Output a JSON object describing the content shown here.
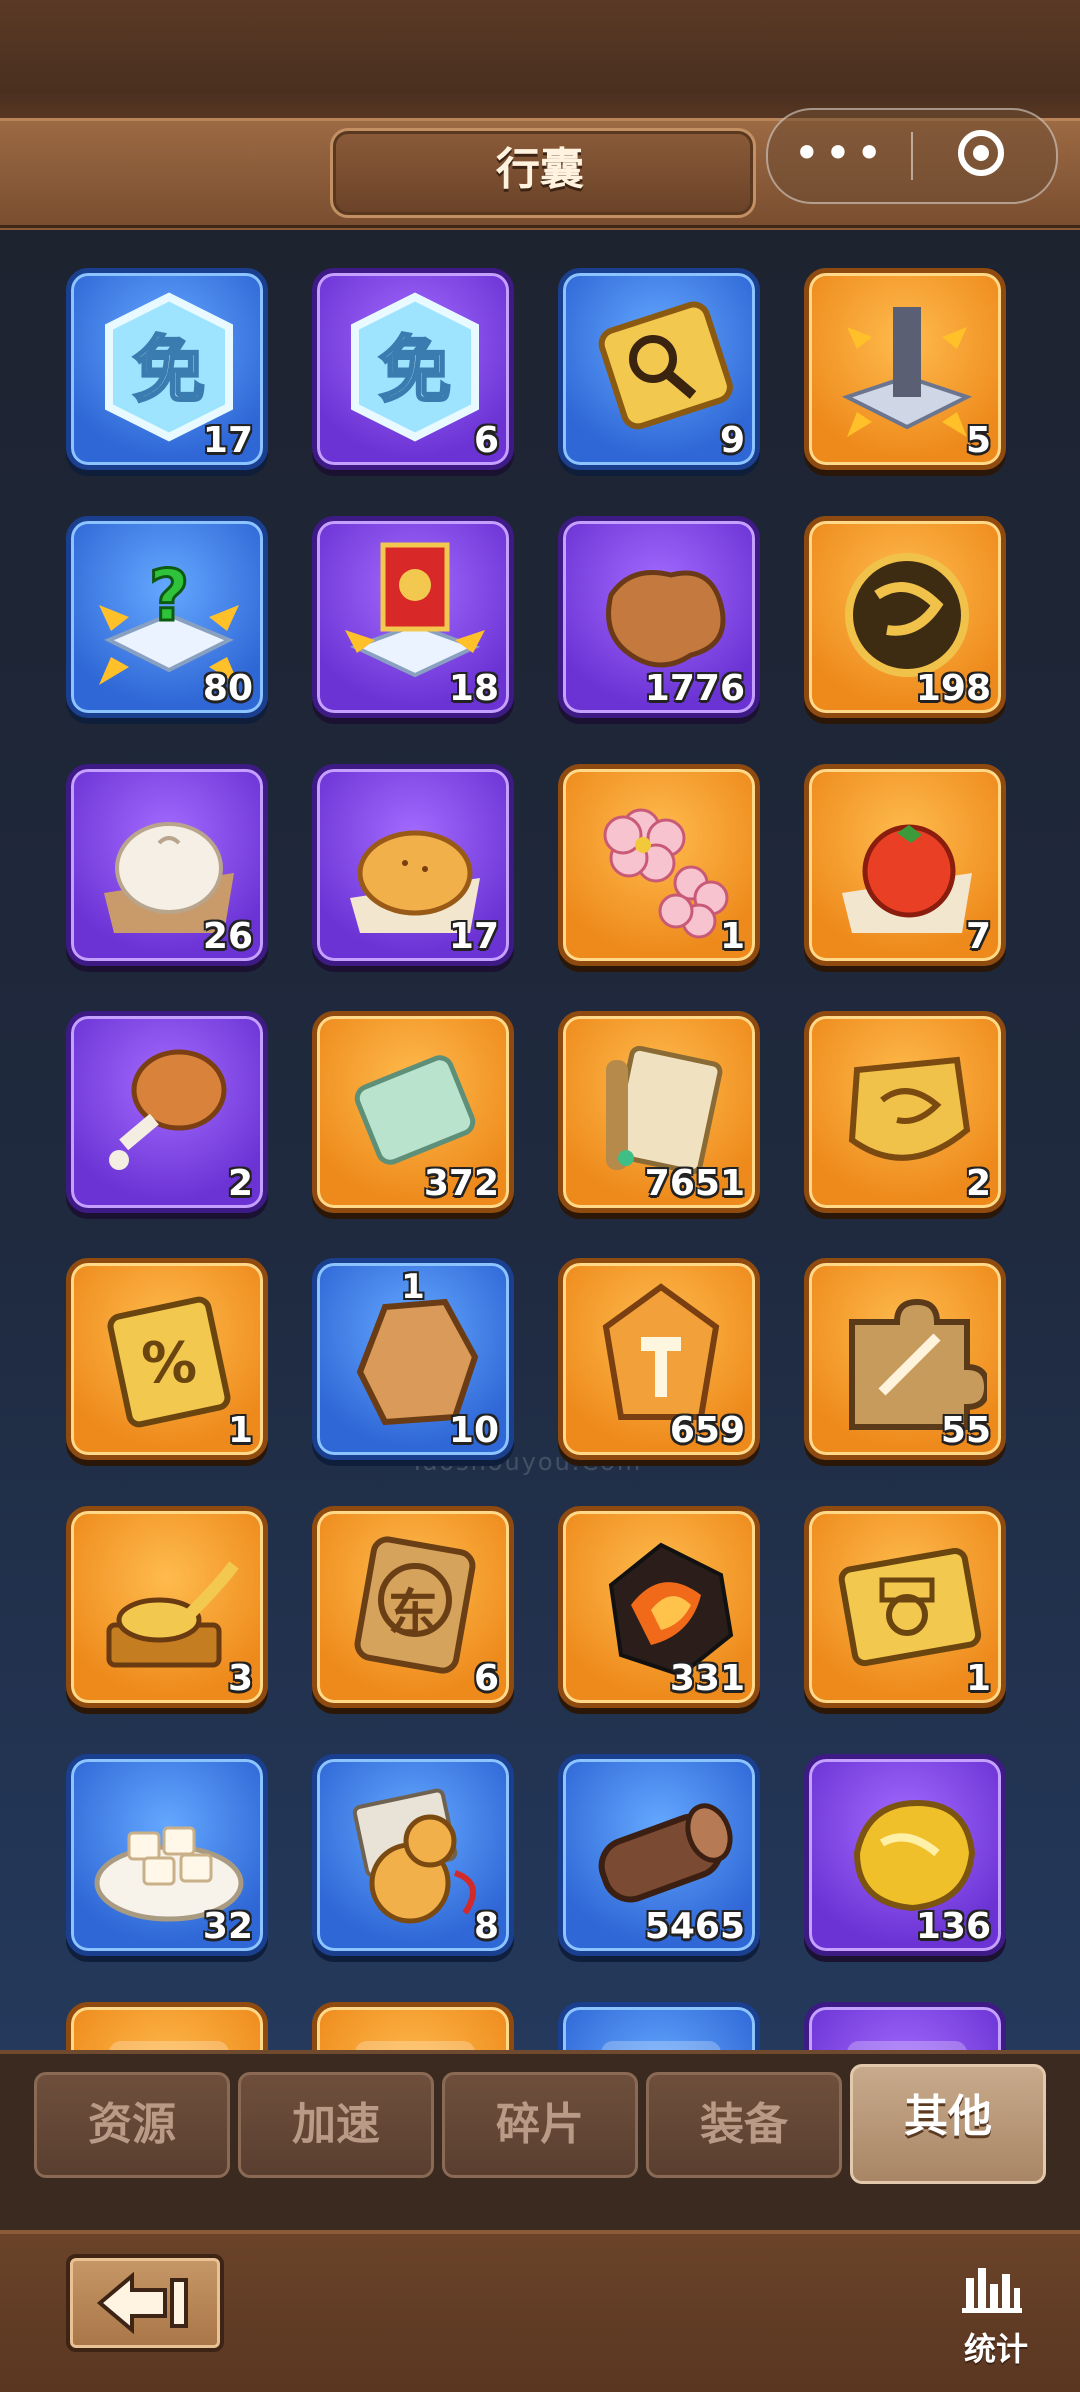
{
  "header": {
    "title": "行囊",
    "more_label": "•••"
  },
  "watermark": "Taoshouyou.Com",
  "items": [
    {
      "name": "protection-shield-blue",
      "rarity": "blue",
      "count": "17",
      "icon": "shield-immune-icon"
    },
    {
      "name": "protection-shield-purple",
      "rarity": "purple",
      "count": "6",
      "icon": "shield-immune-icon"
    },
    {
      "name": "scout-scroll",
      "rarity": "blue",
      "count": "9",
      "icon": "magnifier-plaque-icon"
    },
    {
      "name": "city-relocate",
      "rarity": "orange",
      "count": "5",
      "icon": "city-move-icon"
    },
    {
      "name": "random-relocate",
      "rarity": "blue",
      "count": "80",
      "icon": "question-move-icon"
    },
    {
      "name": "alliance-relocate",
      "rarity": "purple",
      "count": "18",
      "icon": "banner-move-icon"
    },
    {
      "name": "leather",
      "rarity": "purple",
      "count": "1776",
      "icon": "leather-icon"
    },
    {
      "name": "gold-ore-ball",
      "rarity": "orange",
      "count": "198",
      "icon": "gold-ore-icon"
    },
    {
      "name": "steamed-bun",
      "rarity": "purple",
      "count": "26",
      "icon": "bun-icon"
    },
    {
      "name": "pastry",
      "rarity": "purple",
      "count": "17",
      "icon": "pastry-icon"
    },
    {
      "name": "plum-blossom",
      "rarity": "orange",
      "count": "1",
      "icon": "flower-icon"
    },
    {
      "name": "persimmon",
      "rarity": "orange",
      "count": "7",
      "icon": "persimmon-icon"
    },
    {
      "name": "drumstick",
      "rarity": "purple",
      "count": "2",
      "icon": "drumstick-icon"
    },
    {
      "name": "jade-stone",
      "rarity": "orange",
      "count": "372",
      "icon": "jade-icon"
    },
    {
      "name": "imperial-edict",
      "rarity": "orange",
      "count": "7651",
      "icon": "scroll-icon"
    },
    {
      "name": "dragon-token",
      "rarity": "orange",
      "count": "2",
      "icon": "dragon-token-icon"
    },
    {
      "name": "discount-card",
      "rarity": "orange",
      "count": "1",
      "icon": "percent-card-icon"
    },
    {
      "name": "stone-chunk",
      "rarity": "blue",
      "count": "10",
      "extra": "1",
      "icon": "rock-icon"
    },
    {
      "name": "hammer-crystal",
      "rarity": "orange",
      "count": "659",
      "icon": "hammer-crystal-icon"
    },
    {
      "name": "puzzle-piece",
      "rarity": "orange",
      "count": "55",
      "icon": "puzzle-icon"
    },
    {
      "name": "golden-spoon",
      "rarity": "orange",
      "count": "3",
      "icon": "spoon-icon"
    },
    {
      "name": "east-token",
      "rarity": "orange",
      "count": "6",
      "extra_text": "东",
      "icon": "east-token-icon"
    },
    {
      "name": "fire-ore",
      "rarity": "orange",
      "count": "331",
      "icon": "fire-ore-icon"
    },
    {
      "name": "chariot-card",
      "rarity": "orange",
      "count": "1",
      "icon": "chariot-card-icon"
    },
    {
      "name": "tofu-plate",
      "rarity": "blue",
      "count": "32",
      "icon": "tofu-plate-icon"
    },
    {
      "name": "gourd-charm",
      "rarity": "blue",
      "count": "8",
      "icon": "gourd-icon"
    },
    {
      "name": "wood-log",
      "rarity": "blue",
      "count": "5465",
      "icon": "log-icon"
    },
    {
      "name": "gold-nugget",
      "rarity": "purple",
      "count": "136",
      "icon": "gold-nugget-icon"
    },
    {
      "name": "partial-item-1",
      "rarity": "orange",
      "count": "",
      "icon": "partial-icon"
    },
    {
      "name": "partial-item-2",
      "rarity": "orange",
      "count": "",
      "icon": "partial-icon"
    },
    {
      "name": "partial-item-3",
      "rarity": "blue",
      "count": "",
      "icon": "partial-icon"
    },
    {
      "name": "partial-item-4",
      "rarity": "purple",
      "count": "",
      "icon": "partial-icon"
    }
  ],
  "tabs": [
    {
      "label": "资源",
      "active": false
    },
    {
      "label": "加速",
      "active": false
    },
    {
      "label": "碎片",
      "active": false
    },
    {
      "label": "装备",
      "active": false
    },
    {
      "label": "其他",
      "active": true
    }
  ],
  "footer": {
    "stats_label": "统计"
  }
}
